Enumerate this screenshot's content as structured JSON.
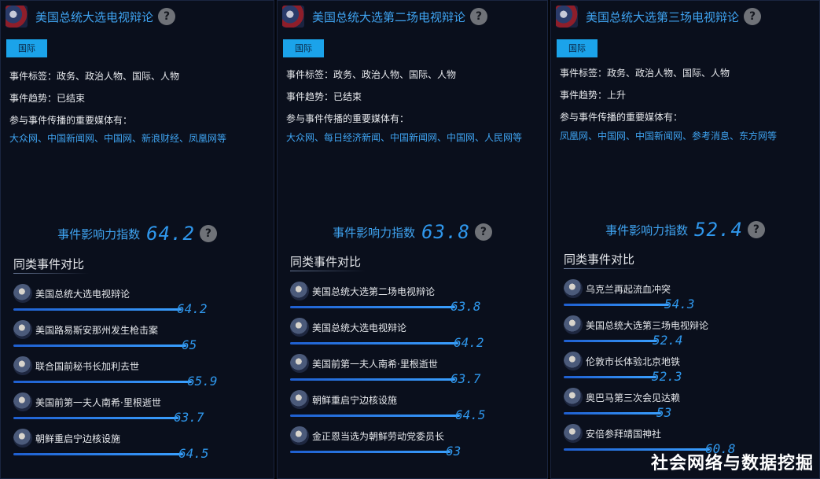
{
  "panels": [
    {
      "title": "美国总统大选电视辩论",
      "tag": "国际",
      "tags_line": "事件标签：政务、政治人物、国际、人物",
      "trend_line": "事件趋势：已结束",
      "media_label": "参与事件传播的重要媒体有：",
      "media": "大众网、中国新闻网、中国网、新浪财经、凤凰网等",
      "impact_label": "事件影响力指数",
      "impact_value": "64.2",
      "compare_title": "同类事件对比",
      "compare": [
        {
          "name": "美国总统大选电视辩论",
          "value": "64.2"
        },
        {
          "name": "美国路易斯安那州发生枪击案",
          "value": "65"
        },
        {
          "name": "联合国前秘书长加利去世",
          "value": "65.9"
        },
        {
          "name": "美国前第一夫人南希·里根逝世",
          "value": "63.7"
        },
        {
          "name": "朝鲜重启宁边核设施",
          "value": "64.5"
        }
      ]
    },
    {
      "title": "美国总统大选第二场电视辩论",
      "tag": "国际",
      "tags_line": "事件标签：政务、政治人物、国际、人物",
      "trend_line": "事件趋势：已结束",
      "media_label": "参与事件传播的重要媒体有：",
      "media": "大众网、每日经济新闻、中国新闻网、中国网、人民网等",
      "impact_label": "事件影响力指数",
      "impact_value": "63.8",
      "compare_title": "同类事件对比",
      "compare": [
        {
          "name": "美国总统大选第二场电视辩论",
          "value": "63.8"
        },
        {
          "name": "美国总统大选电视辩论",
          "value": "64.2"
        },
        {
          "name": "美国前第一夫人南希·里根逝世",
          "value": "63.7"
        },
        {
          "name": "朝鲜重启宁边核设施",
          "value": "64.5"
        },
        {
          "name": "金正恩当选为朝鲜劳动党委员长",
          "value": "63"
        }
      ]
    },
    {
      "title": "美国总统大选第三场电视辩论",
      "tag": "国际",
      "tags_line": "事件标签：政务、政治人物、国际、人物",
      "trend_line": "事件趋势：上升",
      "media_label": "参与事件传播的重要媒体有：",
      "media": "凤凰网、中国网、中国新闻网、参考消息、东方网等",
      "impact_label": "事件影响力指数",
      "impact_value": "52.4",
      "compare_title": "同类事件对比",
      "compare": [
        {
          "name": "乌克兰再起流血冲突",
          "value": "54.3"
        },
        {
          "name": "美国总统大选第三场电视辩论",
          "value": "52.4"
        },
        {
          "name": "伦敦市长体验北京地铁",
          "value": "52.3"
        },
        {
          "name": "奥巴马第三次会见达赖",
          "value": "53"
        },
        {
          "name": "安倍参拜靖国神社",
          "value": "60.8"
        }
      ]
    }
  ],
  "watermark": "社会网络与数据挖掘"
}
